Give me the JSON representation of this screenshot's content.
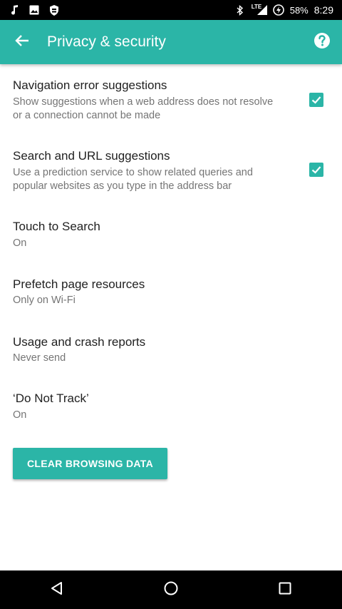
{
  "status_bar": {
    "battery": "58%",
    "time": "8:29",
    "network": "LTE",
    "icons_left": [
      "music-note-icon",
      "image-icon",
      "shield-icon"
    ],
    "icons_right": [
      "bluetooth-icon",
      "signal-icon",
      "battery-charging-icon"
    ]
  },
  "app_bar": {
    "title": "Privacy & security",
    "back_icon": "arrow-back-icon",
    "help_icon": "help-icon",
    "background": "#2bb5a7"
  },
  "preferences": [
    {
      "title": "Navigation error suggestions",
      "summary": "Show suggestions when a web address does not resolve or a connection cannot be made",
      "checked": true
    },
    {
      "title": "Search and URL suggestions",
      "summary": "Use a prediction service to show related queries and popular websites as you type in the address bar",
      "checked": true
    },
    {
      "title": "Touch to Search",
      "summary": "On"
    },
    {
      "title": "Prefetch page resources",
      "summary": "Only on Wi-Fi"
    },
    {
      "title": "Usage and crash reports",
      "summary": "Never send"
    },
    {
      "title": "‘Do Not Track’",
      "summary": "On"
    }
  ],
  "clear_button": {
    "label": "CLEAR BROWSING DATA"
  },
  "nav_bar": {
    "icons": [
      "back-triangle-icon",
      "home-circle-icon",
      "recents-square-icon"
    ]
  },
  "colors": {
    "accent": "#2bb5a7",
    "title_text": "#212121",
    "summary_text": "#757575"
  }
}
